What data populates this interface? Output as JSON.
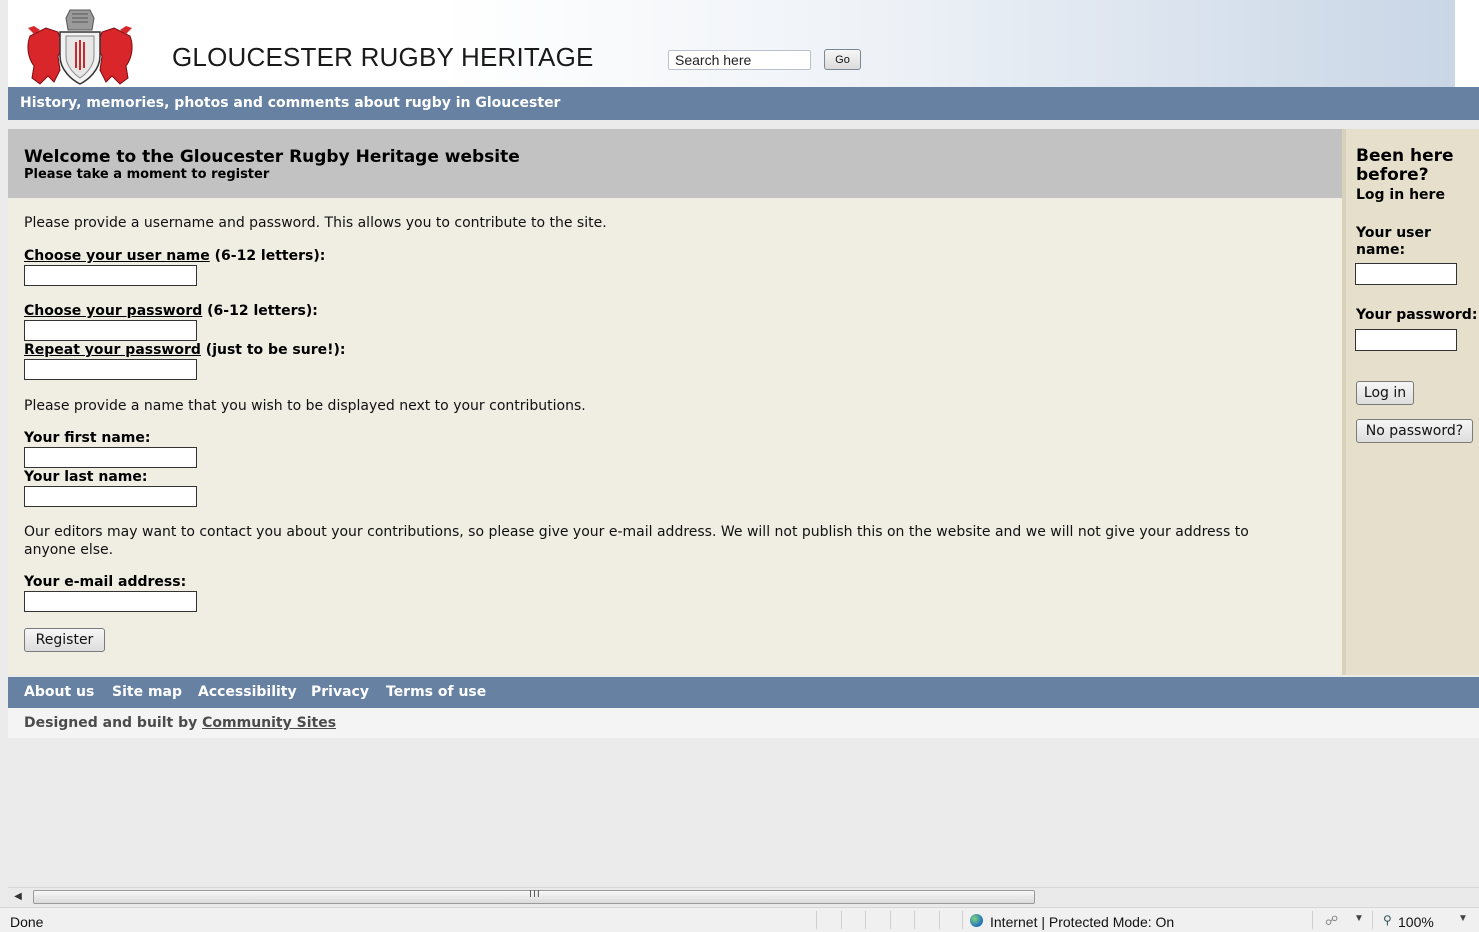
{
  "header": {
    "site_title": "GLOUCESTER RUGBY HERITAGE",
    "search_placeholder": "Search here",
    "search_value": "Search here",
    "go_label": "Go",
    "tagline": "History, memories, photos and comments about rugby in Gloucester"
  },
  "main": {
    "welcome_title": "Welcome to the Gloucester Rugby Heritage website",
    "welcome_subtitle": "Please take a moment to register",
    "intro_text": "Please provide a username and password. This allows you to contribute to the site.",
    "username_label_u": "Choose your user name",
    "username_label_rest": " (6-12 letters):",
    "password_label_u": "Choose your password",
    "password_label_rest": " (6-12 letters):",
    "repeat_label_u": "Repeat your password",
    "repeat_label_rest": " (just to be sure!):",
    "name_text": "Please provide a name that you wish to be displayed next to your contributions.",
    "first_name_label": "Your first name:",
    "last_name_label": "Your last name:",
    "email_text_line1": "Our editors may want to contact you about your contributions, so please give your e-mail address. We will not publish this on the website and we will not give your address to",
    "email_text_line2": "anyone else.",
    "email_label": "Your e-mail address:",
    "register_label": "Register"
  },
  "sidebar": {
    "heading": "Been here before?",
    "subheading": "Log in here",
    "user_label": "Your user name:",
    "password_label": "Your password:",
    "login_label": "Log in",
    "nopassword_label": "No password?"
  },
  "footer": {
    "links": [
      "About us",
      "Site map",
      "Accessibility",
      "Privacy",
      "Terms of use"
    ],
    "credit_prefix": "Designed and built by ",
    "credit_link": "Community Sites"
  },
  "browser": {
    "status": "Done",
    "zone": "Internet | Protected Mode: On",
    "zoom": "100%",
    "scroll_grip": "III"
  },
  "colors": {
    "nav_bar": "#6781a3",
    "main_bg": "#f0ede3",
    "welcome_bg": "#c2c2c2",
    "sidebar_bg": "#e5dfcc"
  },
  "icons": {
    "logo": "crest-lions-shield-icon",
    "zone": "globe-icon",
    "zoom": "magnifier-icon"
  }
}
